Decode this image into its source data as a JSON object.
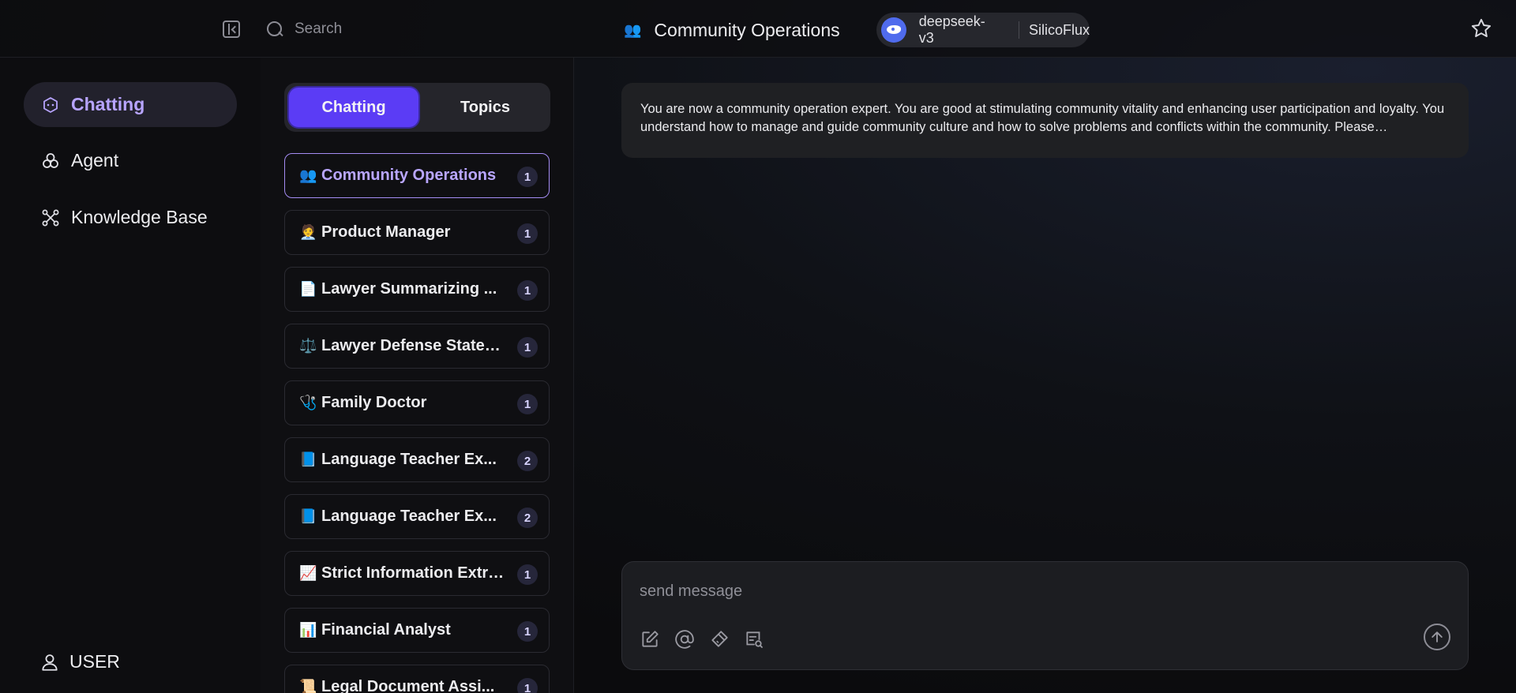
{
  "topbar": {
    "search_placeholder": "Search",
    "conversation_emoji": "👥",
    "conversation_title": "Community Operations",
    "model_name": "deepseek-v3",
    "model_provider": "SilicoFlux"
  },
  "sidebar": {
    "items": [
      {
        "label": "Chatting",
        "icon": "chat-bubble-icon",
        "active": true
      },
      {
        "label": "Agent",
        "icon": "agent-icon",
        "active": false
      },
      {
        "label": "Knowledge Base",
        "icon": "knowledge-graph-icon",
        "active": false
      }
    ],
    "user_label": "USER"
  },
  "topics_panel": {
    "tabs": [
      {
        "label": "Chatting",
        "active": true
      },
      {
        "label": "Topics",
        "active": false
      }
    ],
    "items": [
      {
        "emoji": "👥",
        "label": "Community Operations",
        "count": "1",
        "active": true
      },
      {
        "emoji": "🧑‍💼",
        "label": "Product Manager",
        "count": "1"
      },
      {
        "emoji": "📄",
        "label": "Lawyer Summarizing ...",
        "count": "1"
      },
      {
        "emoji": "⚖️",
        "label": "Lawyer Defense Statement",
        "count": "1"
      },
      {
        "emoji": "🩺",
        "label": "Family Doctor",
        "count": "1"
      },
      {
        "emoji": "📘",
        "label": "Language Teacher Ex...",
        "count": "2"
      },
      {
        "emoji": "📘",
        "label": "Language Teacher Ex...",
        "count": "2"
      },
      {
        "emoji": "📈",
        "label": "Strict Information Extraction",
        "count": "1"
      },
      {
        "emoji": "📊",
        "label": "Financial Analyst",
        "count": "1"
      },
      {
        "emoji": "📜",
        "label": "Legal Document Assi...",
        "count": "1"
      }
    ]
  },
  "main": {
    "system_message": "You are now a community operation expert. You are good at stimulating community vitality and enhancing user participation and loyalty. You understand how to manage and guide community culture and how to solve problems and conflicts within the community. Please…",
    "composer_placeholder": "send message"
  },
  "colors": {
    "accent": "#5b3cf5",
    "accent_text": "#b7a4ff",
    "background": "#0b0b0d"
  }
}
